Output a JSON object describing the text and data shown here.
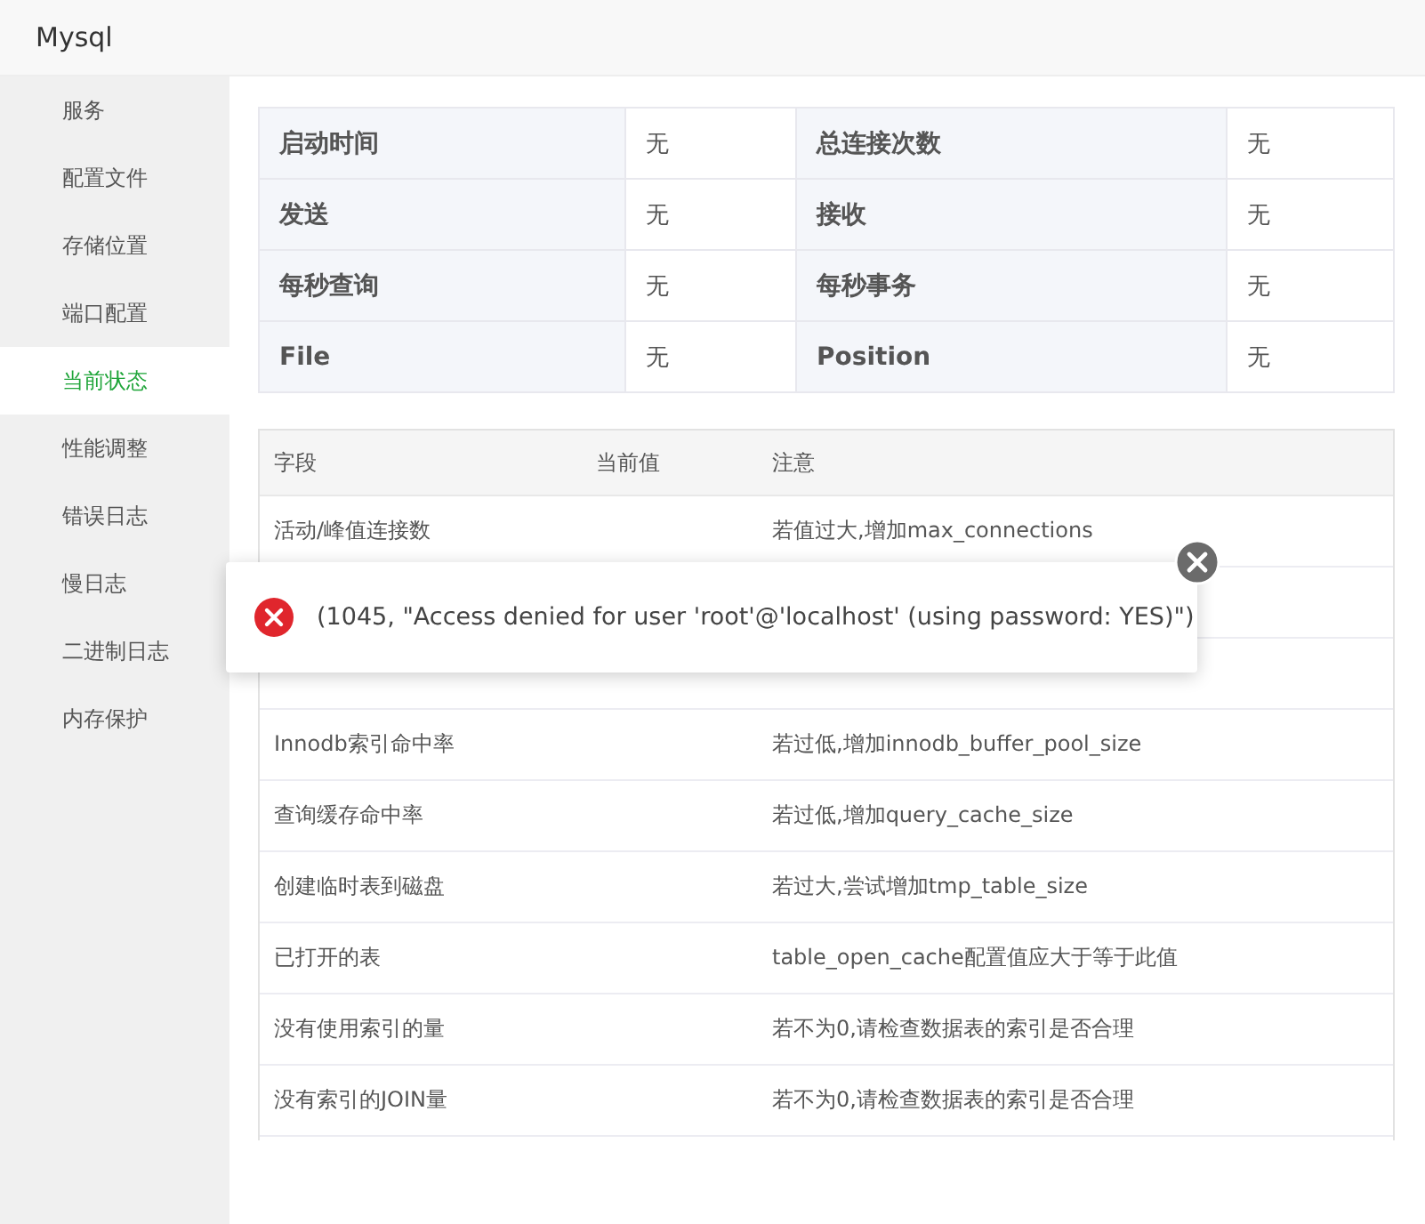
{
  "window": {
    "title": "Mysql"
  },
  "sidebar": {
    "items": [
      {
        "label": "服务",
        "selected": false
      },
      {
        "label": "配置文件",
        "selected": false
      },
      {
        "label": "存储位置",
        "selected": false
      },
      {
        "label": "端口配置",
        "selected": false
      },
      {
        "label": "当前状态",
        "selected": true
      },
      {
        "label": "性能调整",
        "selected": false
      },
      {
        "label": "错误日志",
        "selected": false
      },
      {
        "label": "慢日志",
        "selected": false
      },
      {
        "label": "二进制日志",
        "selected": false
      },
      {
        "label": "内存保护",
        "selected": false
      }
    ]
  },
  "summary": [
    [
      {
        "label": "启动时间",
        "value": "无"
      },
      {
        "label": "总连接次数",
        "value": "无"
      }
    ],
    [
      {
        "label": "发送",
        "value": "无"
      },
      {
        "label": "接收",
        "value": "无"
      }
    ],
    [
      {
        "label": "每秒查询",
        "value": "无"
      },
      {
        "label": "每秒事务",
        "value": "无"
      }
    ],
    [
      {
        "label": "File",
        "value": "无"
      },
      {
        "label": "Position",
        "value": "无"
      }
    ]
  ],
  "status_table": {
    "columns": [
      "字段",
      "当前值",
      "注意"
    ],
    "rows": [
      {
        "field": "活动/峰值连接数",
        "note": "若值过大,增加max_connections"
      },
      {},
      {},
      {
        "field": "Innodb索引命中率",
        "note": "若过低,增加innodb_buffer_pool_size"
      },
      {
        "field": "查询缓存命中率",
        "note": "若过低,增加query_cache_size"
      },
      {
        "field": "创建临时表到磁盘",
        "note": "若过大,尝试增加tmp_table_size"
      },
      {
        "field": "已打开的表",
        "note": "table_open_cache配置值应大于等于此值"
      },
      {
        "field": "没有使用索引的量",
        "note": "若不为0,请检查数据表的索引是否合理"
      },
      {
        "field": "没有索引的JOIN量",
        "note": "若不为0,请检查数据表的索引是否合理"
      }
    ]
  },
  "error_toast": {
    "message": "(1045, \"Access denied for user 'root'@'localhost' (using password: YES)\")"
  }
}
